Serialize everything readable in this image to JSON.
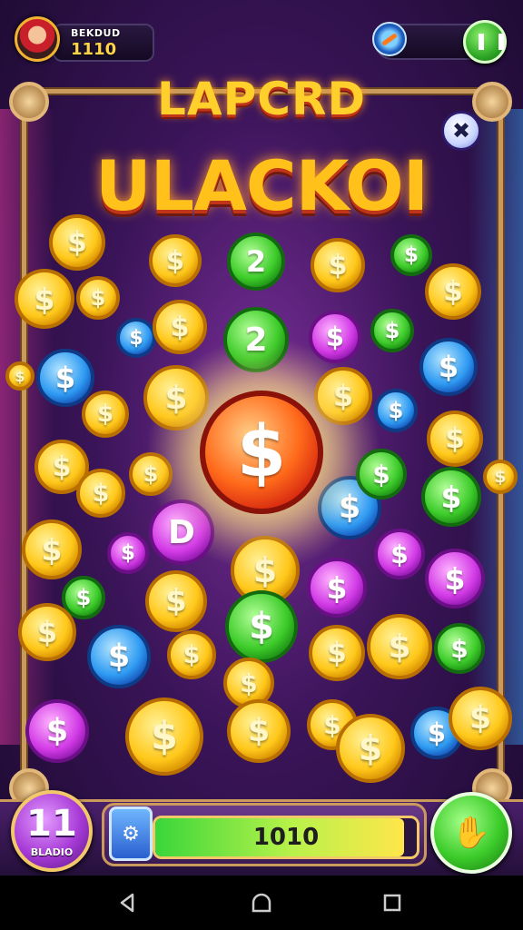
{
  "hud": {
    "player_name": "BEKDUD",
    "player_score": "1110"
  },
  "title": {
    "line1": "LAPCRD",
    "line2": "ULACKOI"
  },
  "close_label": "✖",
  "coin_symbol": "$",
  "coin_alt_symbols": [
    "2",
    "2",
    "D"
  ],
  "bottom": {
    "level_number": "11",
    "level_label": "BLADIO",
    "progress_value": "1010",
    "progress_fraction": 0.95,
    "booster_label": "⚙"
  },
  "colors": {
    "gold": "#ffc81a",
    "green": "#3dcc2a",
    "blue": "#2e9af2",
    "purple": "#d23ae6",
    "red": "#ff6a1a",
    "frame": "#c99a5c"
  },
  "icons": {
    "avatar": "player-avatar",
    "compass": "compass-icon",
    "top_right": "pause-icon",
    "close": "close-icon",
    "booster": "booster-icon",
    "play": "hand-icon",
    "nav": [
      "back-icon",
      "home-icon",
      "recent-apps-icon"
    ]
  }
}
